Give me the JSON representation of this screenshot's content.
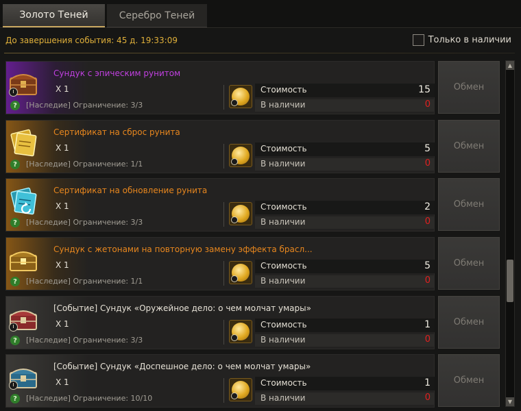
{
  "tabs": [
    {
      "label": "Золото Теней",
      "active": true
    },
    {
      "label": "Серебро Теней",
      "active": false
    }
  ],
  "header": {
    "timer": "До завершения события: 45 д. 19:33:09",
    "only_available_label": "Только в наличии",
    "only_available_checked": false
  },
  "labels": {
    "cost": "Стоимость",
    "available": "В наличии",
    "exchange": "Обмен"
  },
  "items": [
    {
      "name": "Сундук с эпическим рунитом",
      "name_color": "#c040e0",
      "quantity": "X 1",
      "limit": "[Наследие] Ограничение: 3/3",
      "cost": "15",
      "available": "0",
      "icon": "chest-icon"
    },
    {
      "name": "Сертификат на сброс рунита",
      "name_color": "#e8871e",
      "quantity": "X 1",
      "limit": "[Наследие] Ограничение: 1/1",
      "cost": "5",
      "available": "0",
      "icon": "certificate-icon"
    },
    {
      "name": "Сертификат на обновление рунита",
      "name_color": "#e8871e",
      "quantity": "X 1",
      "limit": "[Наследие] Ограничение: 3/3",
      "cost": "2",
      "available": "0",
      "icon": "certificate-icon"
    },
    {
      "name": "Сундук с жетонами на повторную замену эффекта брасл...",
      "name_color": "#e8871e",
      "quantity": "X 1",
      "limit": "[Наследие] Ограничение: 1/1",
      "cost": "5",
      "available": "0",
      "icon": "chest-icon"
    },
    {
      "name": "[Событие] Сундук «Оружейное дело: о чем молчат умары»",
      "name_color": "#e6e1d6",
      "quantity": "X 1",
      "limit": "[Наследие] Ограничение: 3/3",
      "cost": "1",
      "available": "0",
      "icon": "chest-icon"
    },
    {
      "name": "[Событие] Сундук «Доспешное дело: о чем молчат умары»",
      "name_color": "#e6e1d6",
      "quantity": "X 1",
      "limit": "[Наследие] Ограничение: 10/10",
      "cost": "1",
      "available": "0",
      "icon": "chest-icon"
    }
  ],
  "colors": {
    "timer": "#e0b03a",
    "epic_glow": "#6a1f9a",
    "legendary_glow": "#8a5410",
    "available_zero": "#e02020"
  }
}
